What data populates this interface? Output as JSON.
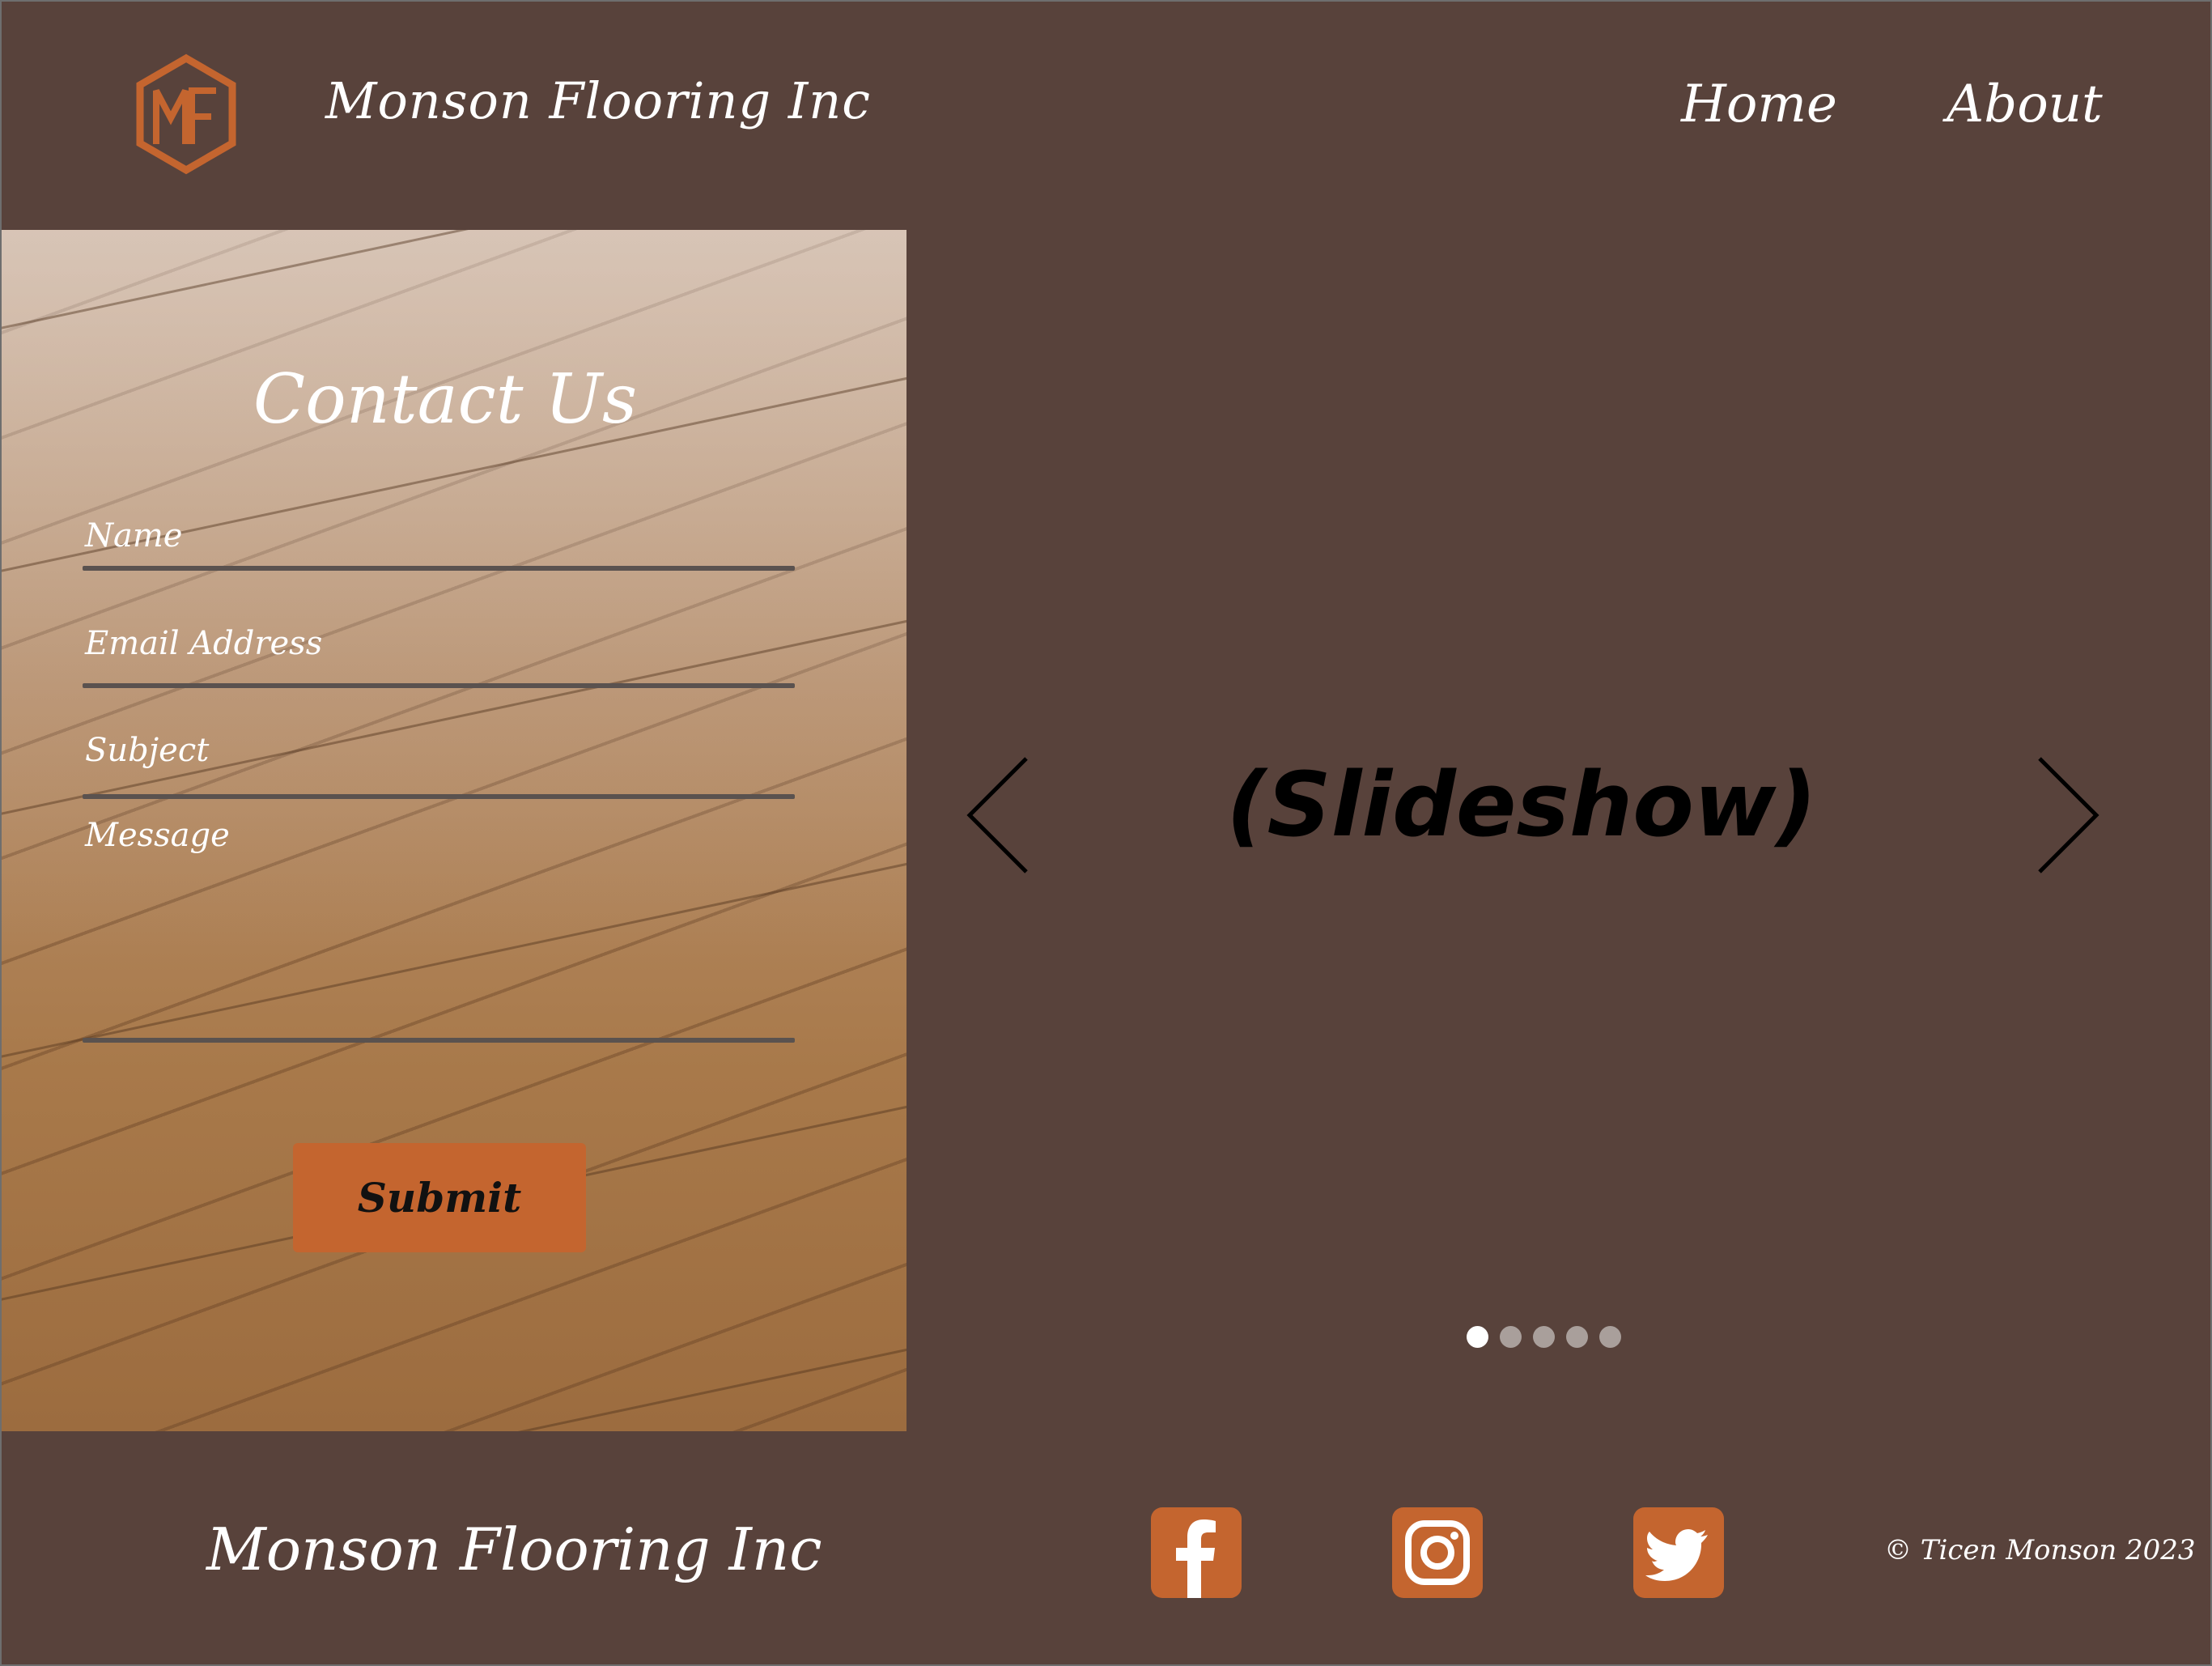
{
  "header": {
    "brand": "Monson Flooring Inc",
    "logo_text": "MF",
    "nav": [
      {
        "label": "Home"
      },
      {
        "label": "About"
      }
    ]
  },
  "contact": {
    "title": "Contact Us",
    "fields": {
      "name": "Name",
      "email": "Email Address",
      "subject": "Subject",
      "message": "Message"
    },
    "submit_label": "Submit"
  },
  "slideshow": {
    "label": "(Slideshow)",
    "slide_count": 5,
    "active_index": 0
  },
  "footer": {
    "brand": "Monson Flooring Inc",
    "social": [
      {
        "icon": "facebook-icon"
      },
      {
        "icon": "instagram-icon"
      },
      {
        "icon": "twitter-icon"
      }
    ],
    "copyright": "© Ticen Monson 2023"
  },
  "colors": {
    "background": "#58423b",
    "accent": "#c4652f",
    "text": "#ffffff"
  }
}
